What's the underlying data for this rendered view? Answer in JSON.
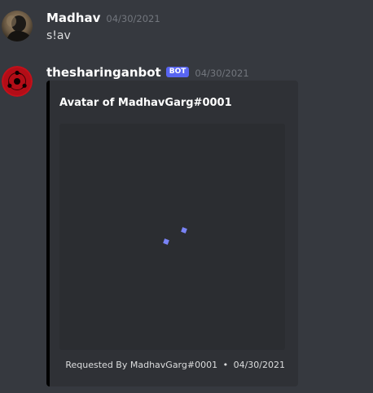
{
  "messages": [
    {
      "username": "Madhav",
      "timestamp": "04/30/2021",
      "content": "s!av"
    },
    {
      "username": "thesharinganbot",
      "bot_tag": "BOT",
      "timestamp": "04/30/2021",
      "embed": {
        "title": "Avatar of MadhavGarg#0001",
        "footer_text": "Requested By MadhavGarg#0001",
        "footer_separator": "•",
        "footer_timestamp": "04/30/2021",
        "border_color": "#000000",
        "image_state": "loading"
      }
    }
  ],
  "theme": {
    "background": "#36393f",
    "embed_background": "#2f3136",
    "bot_tag_color": "#5865f2",
    "spinner_color": "#7983f5"
  }
}
